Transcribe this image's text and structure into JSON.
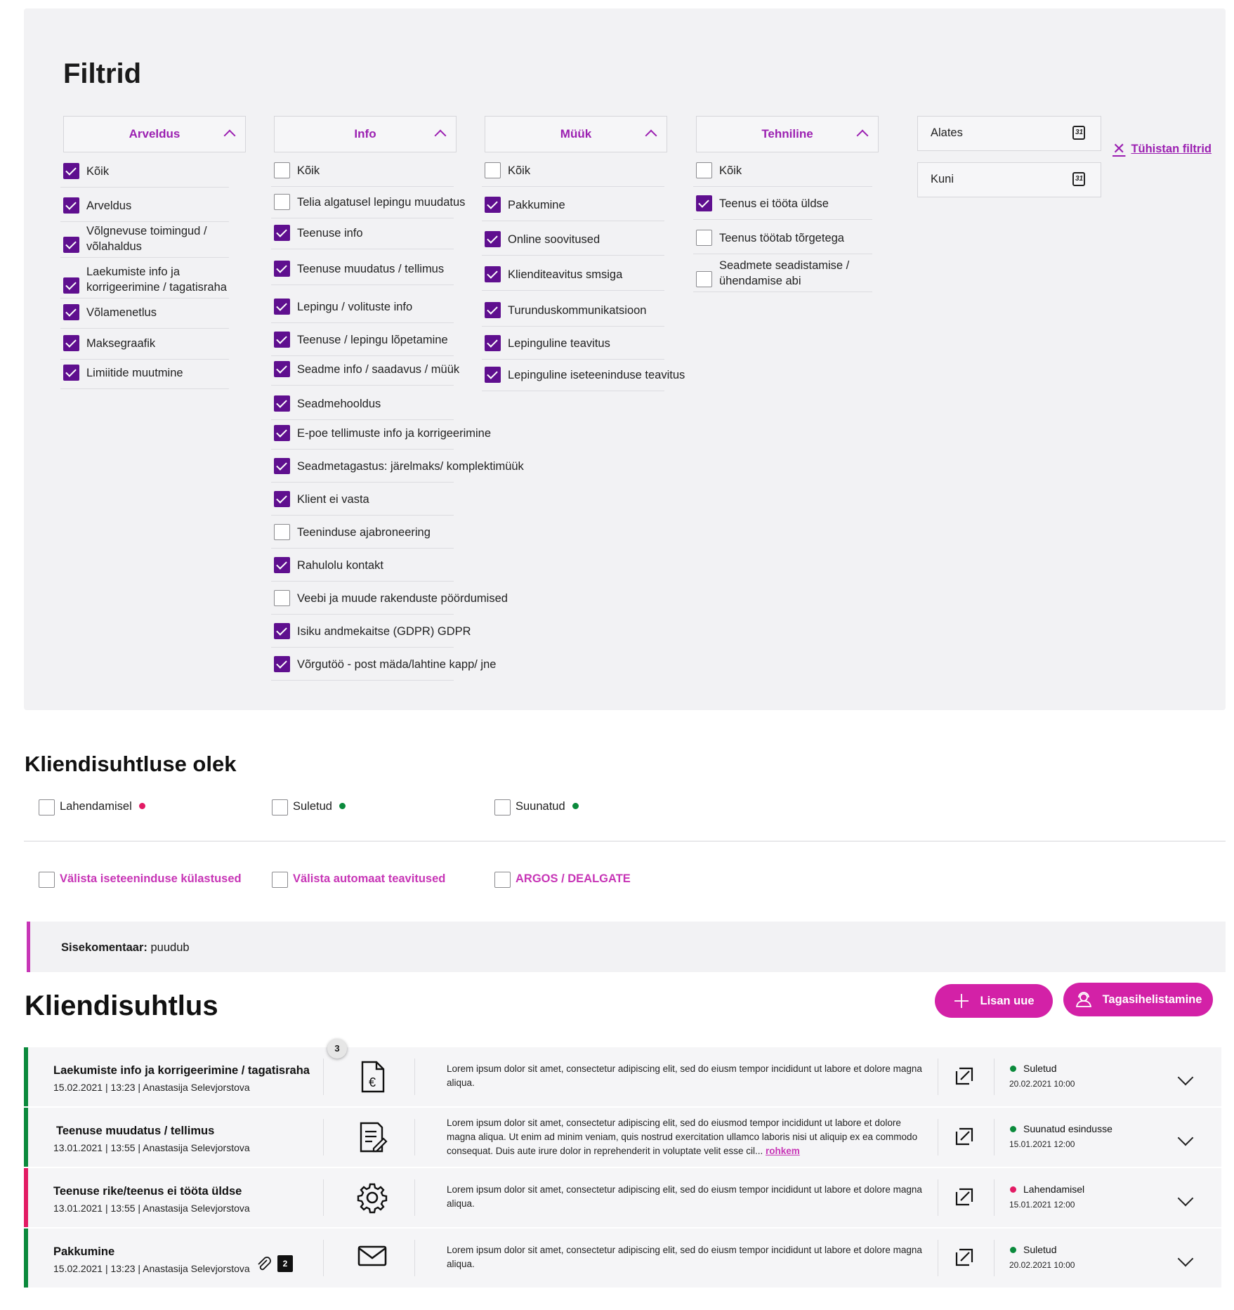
{
  "filters": {
    "title": "Filtrid",
    "columns": [
      {
        "header": "Arveldus",
        "items": [
          {
            "label": "Kõik",
            "checked": true
          },
          {
            "label": "Arveldus",
            "checked": true
          },
          {
            "label": "Võlgnevuse toimingud / võlahaldus",
            "checked": true
          },
          {
            "label": "Laekumiste info ja korrigeerimine / tagatisraha",
            "checked": true
          },
          {
            "label": "Võlamenetlus",
            "checked": true
          },
          {
            "label": "Maksegraafik",
            "checked": true
          },
          {
            "label": "Limiitide muutmine",
            "checked": true
          }
        ]
      },
      {
        "header": "Info",
        "items": [
          {
            "label": "Kõik",
            "checked": false
          },
          {
            "label": "Telia algatusel lepingu muudatus",
            "checked": false
          },
          {
            "label": "Teenuse info",
            "checked": true
          },
          {
            "label": "Teenuse muudatus / tellimus",
            "checked": true
          },
          {
            "label": "Lepingu / volituste info",
            "checked": true
          },
          {
            "label": "Teenuse / lepingu lõpetamine",
            "checked": true
          },
          {
            "label": "Seadme info / saadavus / müük",
            "checked": true
          },
          {
            "label": "Seadmehooldus",
            "checked": true
          },
          {
            "label": "E-poe tellimuste info ja korrigeerimine",
            "checked": true
          },
          {
            "label": "Seadmetagastus: järelmaks/ komplektimüük",
            "checked": true
          },
          {
            "label": "Klient ei vasta",
            "checked": true
          },
          {
            "label": "Teeninduse ajabroneering",
            "checked": false
          },
          {
            "label": "Rahulolu kontakt",
            "checked": true
          },
          {
            "label": "Veebi ja muude rakenduste pöördumised",
            "checked": false
          },
          {
            "label": "Isiku andmekaitse (GDPR) GDPR",
            "checked": true
          },
          {
            "label": "Võrgutöö - post mäda/lahtine kapp/ jne",
            "checked": true
          }
        ]
      },
      {
        "header": "Müük",
        "items": [
          {
            "label": "Kõik",
            "checked": false
          },
          {
            "label": "Pakkumine",
            "checked": true
          },
          {
            "label": "Online soovitused",
            "checked": true
          },
          {
            "label": "Klienditeavitus smsiga",
            "checked": true
          },
          {
            "label": "Turunduskommunikatsioon",
            "checked": true
          },
          {
            "label": "Lepinguline teavitus",
            "checked": true
          },
          {
            "label": "Lepinguline iseteeninduse teavitus",
            "checked": true
          }
        ]
      },
      {
        "header": "Tehniline",
        "items": [
          {
            "label": "Kõik",
            "checked": false
          },
          {
            "label": "Teenus ei tööta üldse",
            "checked": true
          },
          {
            "label": "Teenus töötab tõrgetega",
            "checked": false
          },
          {
            "label": "Seadmete seadistamise / ühendamise abi",
            "checked": false
          }
        ]
      }
    ],
    "date_from_label": "Alates",
    "date_to_label": "Kuni",
    "clear_label": "Tühistan filtrid"
  },
  "state": {
    "title": "Kliendisuhtluse olek",
    "options": [
      {
        "label": "Lahendamisel",
        "color": "#e21b64"
      },
      {
        "label": "Suletud",
        "color": "#0b8a3c"
      },
      {
        "label": "Suunatud",
        "color": "#0b8a3c"
      }
    ],
    "exclusions": [
      {
        "label": "Välista iseteeninduse külastused"
      },
      {
        "label": "Välista automaat teavitused"
      },
      {
        "label": "ARGOS / DEALGATE"
      }
    ]
  },
  "comment": {
    "label": "Sisekomentaar:",
    "value": "puudub"
  },
  "list": {
    "title": "Kliendisuhtlus",
    "add_label": "Lisan uue",
    "callback_label": "Tagasihelistamine",
    "badge_count": "3",
    "rows": [
      {
        "title": "Laekumiste info ja korrigeerimine / tagatisraha",
        "meta": "15.02.2021 | 13:23 | Anastasija Selevjorstova",
        "icon": "euro-document-icon",
        "desc": "Lorem ipsum dolor sit amet, consectetur adipiscing elit, sed do eiusm tempor incididunt ut labore et dolore magna aliqua.",
        "status": "Suletud",
        "status_date": "20.02.2021 10:00",
        "status_color": "#0b8a3c"
      },
      {
        "title": "Teenuse muudatus / tellimus",
        "meta": "13.01.2021 | 13:55 | Anastasija Selevjorstova",
        "icon": "document-edit-icon",
        "desc": "Lorem ipsum dolor sit amet, consectetur adipiscing elit, sed do eiusmod tempor incididunt ut labore et dolore magna aliqua. Ut enim ad minim veniam, quis nostrud exercitation ullamco laboris nisi ut aliquip ex ea commodo consequat. Duis aute irure dolor in reprehenderit in voluptate velit esse cil...",
        "more": "rohkem",
        "status": "Suunatud esindusse",
        "status_date": "15.01.2021 12:00",
        "status_color": "#0b8a3c"
      },
      {
        "title": "Teenuse rike/teenus ei tööta üldse",
        "meta": "13.01.2021 | 13:55 | Anastasija Selevjorstova",
        "icon": "gear-icon",
        "desc": "Lorem ipsum dolor sit amet, consectetur adipiscing elit, sed do eiusm tempor incididunt ut labore et dolore magna aliqua.",
        "status": "Lahendamisel",
        "status_date": "15.01.2021 12:00",
        "status_color": "#e21b64"
      },
      {
        "title": "Pakkumine",
        "meta": "15.02.2021 | 13:23 | Anastasija Selevjorstova",
        "icon": "envelope-icon",
        "attachments": "2",
        "desc": "Lorem ipsum dolor sit amet, consectetur adipiscing elit, sed do eiusm tempor incididunt ut labore et dolore magna aliqua.",
        "status": "Suletud",
        "status_date": "20.02.2021 10:00",
        "status_color": "#0b8a3c"
      }
    ]
  }
}
